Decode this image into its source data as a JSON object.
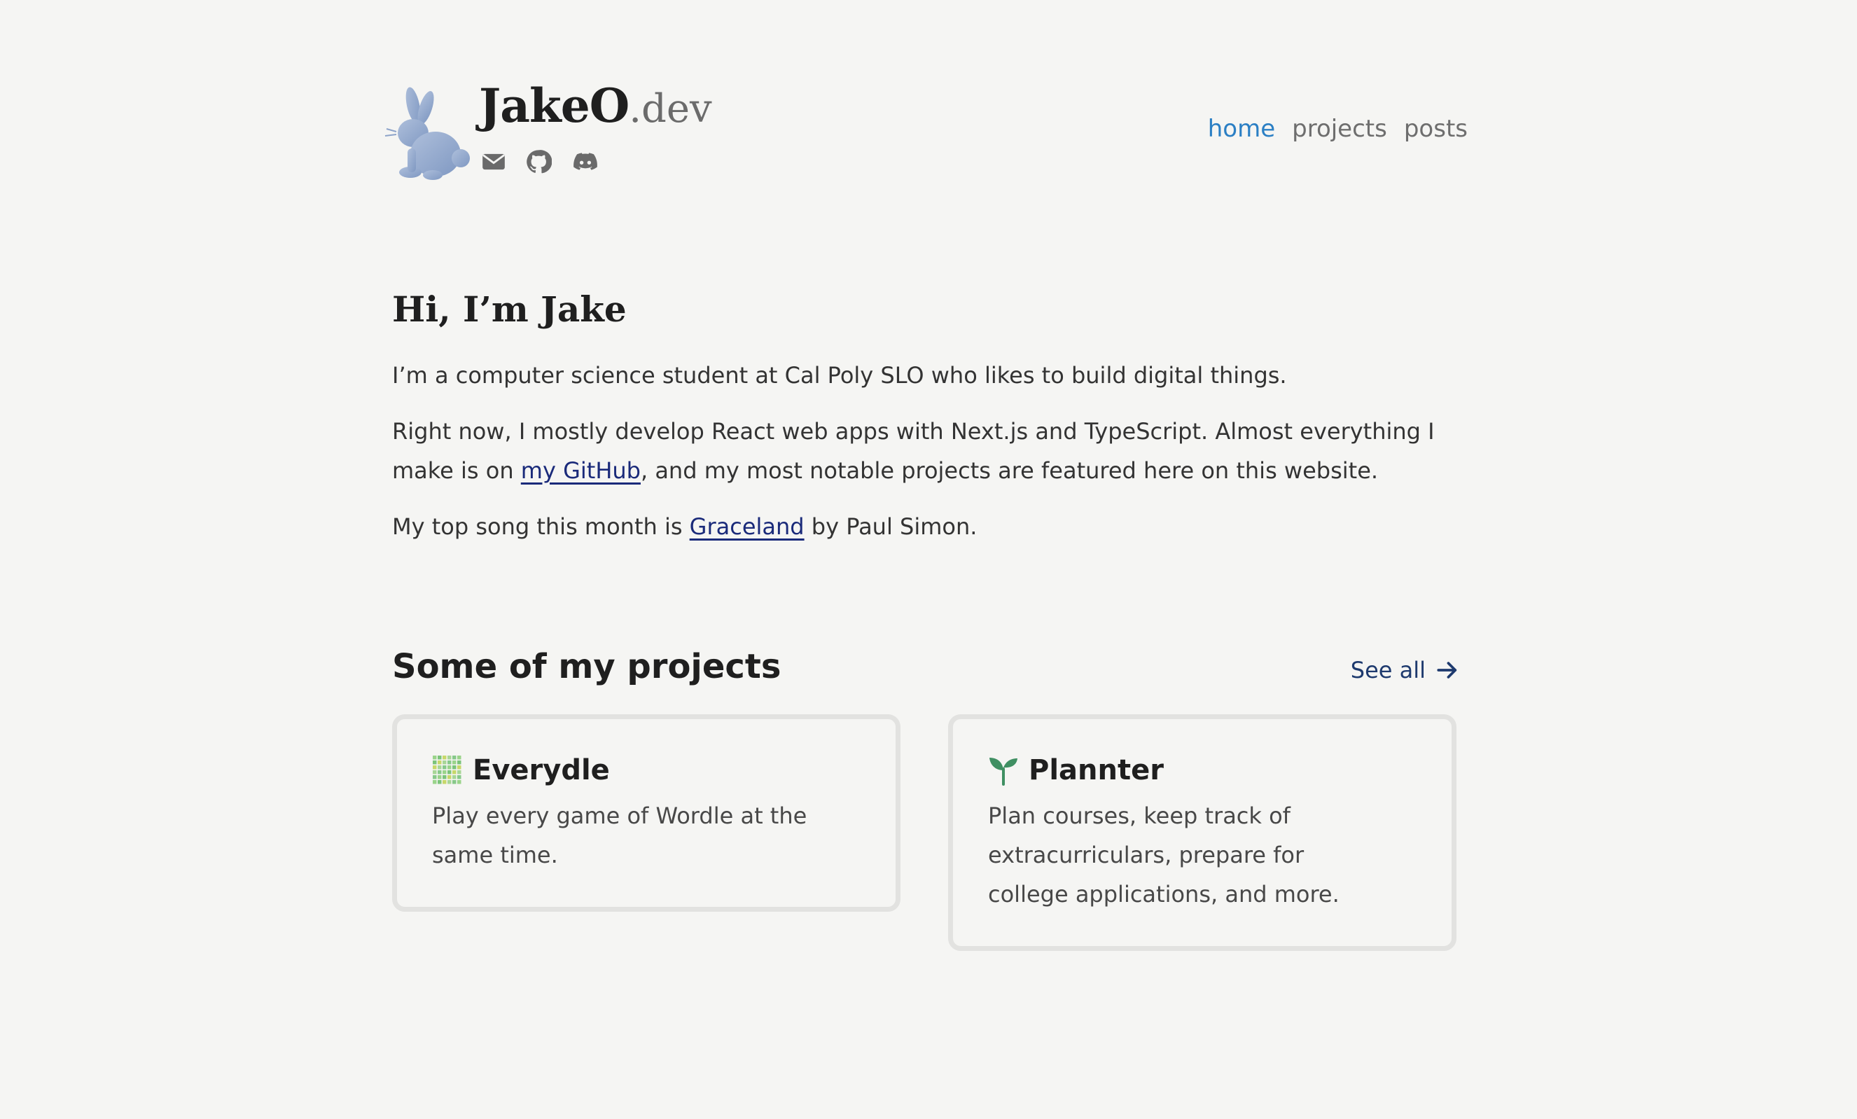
{
  "site": {
    "brand_main": "JakeO",
    "brand_tld": ".dev",
    "logo_icon": "rabbit-icon",
    "socials": [
      "email-icon",
      "github-icon",
      "discord-icon"
    ]
  },
  "nav": {
    "items": [
      {
        "label": "home",
        "active": true
      },
      {
        "label": "projects",
        "active": false
      },
      {
        "label": "posts",
        "active": false
      }
    ],
    "active_color": "#2b7fc4"
  },
  "intro": {
    "heading": "Hi, I’m Jake",
    "p1": "I’m a computer science student at Cal Poly SLO who likes to build digital things.",
    "p2_before": "Right now, I mostly develop React web apps with Next.js and TypeScript. Almost everything I make is on ",
    "p2_link": "my GitHub",
    "p2_after": ", and my most notable projects are featured here on this website.",
    "p3_before": "My top song this month is ",
    "p3_link": "Graceland",
    "p3_after": " by Paul Simon."
  },
  "projects": {
    "heading": "Some of my projects",
    "see_all": "See all",
    "items": [
      {
        "name": "Everydle",
        "icon": "grid-icon",
        "description": "Play every game of Wordle at the same time."
      },
      {
        "name": "Plannter",
        "icon": "sprout-icon",
        "description": "Plan courses, keep track of extracurriculars, prepare for college applications, and more."
      }
    ]
  }
}
